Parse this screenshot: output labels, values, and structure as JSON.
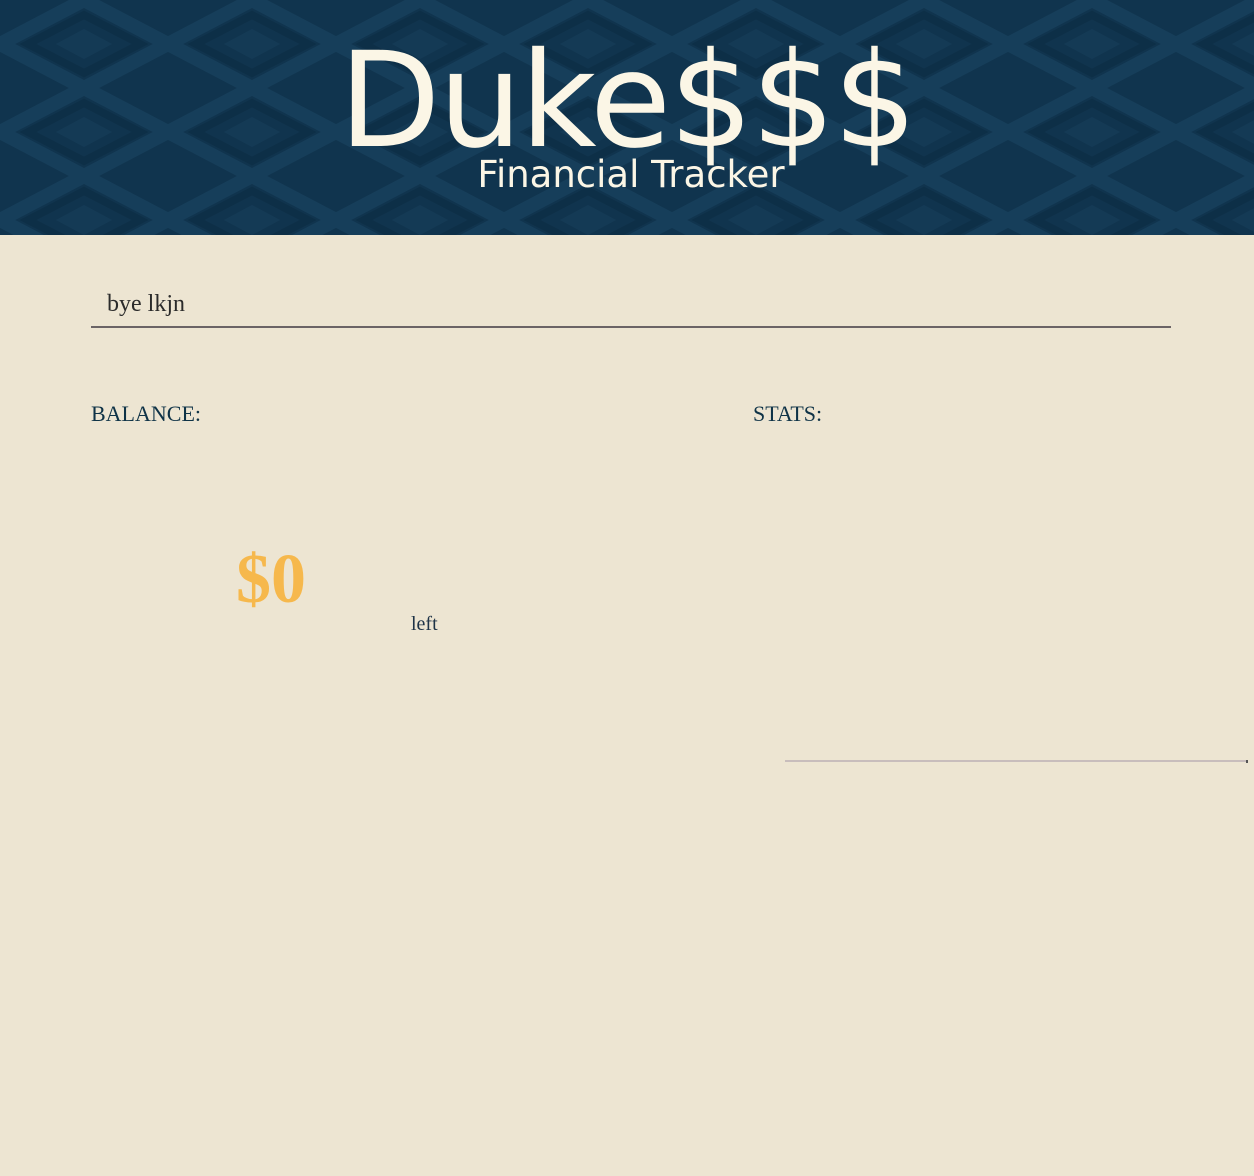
{
  "header": {
    "title": "Duke$$$",
    "subtitle": "Financial Tracker"
  },
  "name_input": {
    "value": "bye lkjn"
  },
  "balance": {
    "label": "BALANCE:",
    "amount": "$0",
    "suffix": "left"
  },
  "stats": {
    "label": "STATS:"
  },
  "colors": {
    "header_bg": "#10344e",
    "page_bg": "#ede5d2",
    "title_text": "#fbf6e6",
    "accent_amount": "#f6b84c",
    "label_text": "#0f3347"
  }
}
